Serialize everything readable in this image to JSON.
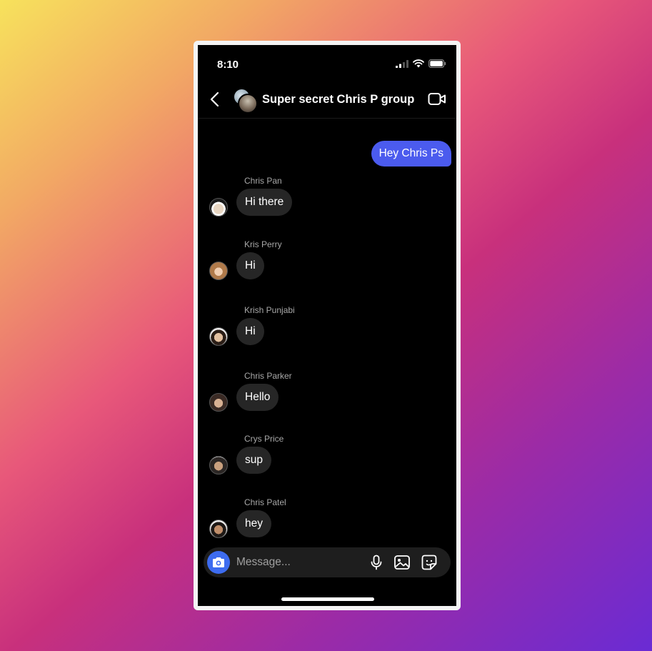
{
  "status_bar": {
    "time": "8:10",
    "icons": [
      "signal-icon",
      "wifi-icon",
      "battery-icon"
    ]
  },
  "header": {
    "back_icon": "chevron-left-icon",
    "title": "Super secret Chris P group",
    "video_icon": "video-camera-icon"
  },
  "messages": {
    "outgoing": {
      "text": "Hey Chris Ps",
      "color": "#4b5bee"
    },
    "incoming": [
      {
        "sender": "Chris Pan",
        "text": "Hi there"
      },
      {
        "sender": "Kris Perry",
        "text": "Hi"
      },
      {
        "sender": "Krish Punjabi",
        "text": "Hi"
      },
      {
        "sender": "Chris Parker",
        "text": "Hello"
      },
      {
        "sender": "Crys Price",
        "text": "sup"
      },
      {
        "sender": "Chris Patel",
        "text": "hey"
      }
    ]
  },
  "composer": {
    "placeholder": "Message...",
    "camera_icon": "camera-icon",
    "icons": [
      "microphone-icon",
      "image-icon",
      "sticker-icon"
    ],
    "camera_color": "#3d6cf0"
  }
}
